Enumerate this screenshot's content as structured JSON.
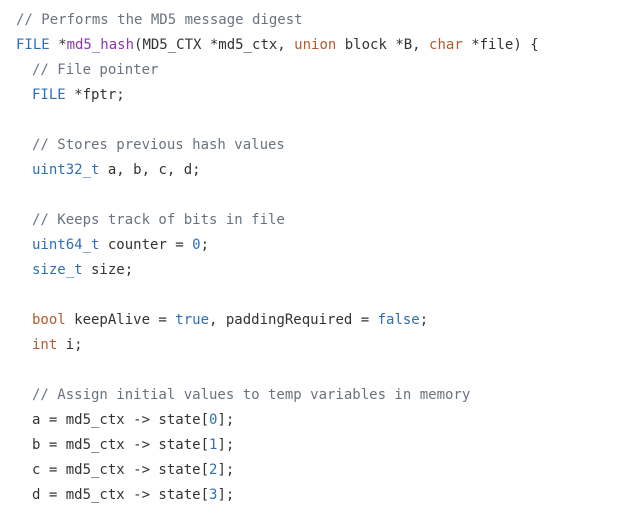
{
  "code": {
    "lines": [
      {
        "indent": 0,
        "tokens": [
          {
            "t": "// Performs the MD5 message digest",
            "k": "comment"
          }
        ]
      },
      {
        "indent": 0,
        "tokens": [
          {
            "t": "FILE",
            "k": "type"
          },
          {
            "t": " *",
            "k": "plain"
          },
          {
            "t": "md5_hash",
            "k": "func"
          },
          {
            "t": "(MD5_CTX *md5_ctx, ",
            "k": "plain"
          },
          {
            "t": "union",
            "k": "keyword"
          },
          {
            "t": " block *B, ",
            "k": "plain"
          },
          {
            "t": "char",
            "k": "keyword"
          },
          {
            "t": " *file) {",
            "k": "plain"
          }
        ]
      },
      {
        "indent": 1,
        "tokens": [
          {
            "t": "// File pointer",
            "k": "comment"
          }
        ]
      },
      {
        "indent": 1,
        "tokens": [
          {
            "t": "FILE",
            "k": "type"
          },
          {
            "t": " *fptr;",
            "k": "plain"
          }
        ]
      },
      {
        "indent": 1,
        "tokens": []
      },
      {
        "indent": 1,
        "tokens": [
          {
            "t": "// Stores previous hash values",
            "k": "comment"
          }
        ]
      },
      {
        "indent": 1,
        "tokens": [
          {
            "t": "uint32_t",
            "k": "type"
          },
          {
            "t": " a, b, c, d;",
            "k": "plain"
          }
        ]
      },
      {
        "indent": 1,
        "tokens": []
      },
      {
        "indent": 1,
        "tokens": [
          {
            "t": "// Keeps track of bits in file",
            "k": "comment"
          }
        ]
      },
      {
        "indent": 1,
        "tokens": [
          {
            "t": "uint64_t",
            "k": "type"
          },
          {
            "t": " counter = ",
            "k": "plain"
          },
          {
            "t": "0",
            "k": "value"
          },
          {
            "t": ";",
            "k": "plain"
          }
        ]
      },
      {
        "indent": 1,
        "tokens": [
          {
            "t": "size_t",
            "k": "type"
          },
          {
            "t": " size;",
            "k": "plain"
          }
        ]
      },
      {
        "indent": 1,
        "tokens": []
      },
      {
        "indent": 1,
        "tokens": [
          {
            "t": "bool",
            "k": "keyword"
          },
          {
            "t": " keepAlive = ",
            "k": "plain"
          },
          {
            "t": "true",
            "k": "value"
          },
          {
            "t": ", paddingRequired = ",
            "k": "plain"
          },
          {
            "t": "false",
            "k": "value"
          },
          {
            "t": ";",
            "k": "plain"
          }
        ]
      },
      {
        "indent": 1,
        "tokens": [
          {
            "t": "int",
            "k": "keyword"
          },
          {
            "t": " i;",
            "k": "plain"
          }
        ]
      },
      {
        "indent": 1,
        "tokens": []
      },
      {
        "indent": 1,
        "tokens": [
          {
            "t": "// Assign initial values to temp variables in memory",
            "k": "comment"
          }
        ]
      },
      {
        "indent": 1,
        "tokens": [
          {
            "t": "a = md5_ctx -> state[",
            "k": "plain"
          },
          {
            "t": "0",
            "k": "value"
          },
          {
            "t": "];",
            "k": "plain"
          }
        ]
      },
      {
        "indent": 1,
        "tokens": [
          {
            "t": "b = md5_ctx -> state[",
            "k": "plain"
          },
          {
            "t": "1",
            "k": "value"
          },
          {
            "t": "];",
            "k": "plain"
          }
        ]
      },
      {
        "indent": 1,
        "tokens": [
          {
            "t": "c = md5_ctx -> state[",
            "k": "plain"
          },
          {
            "t": "2",
            "k": "value"
          },
          {
            "t": "];",
            "k": "plain"
          }
        ]
      },
      {
        "indent": 1,
        "tokens": [
          {
            "t": "d = md5_ctx -> state[",
            "k": "plain"
          },
          {
            "t": "3",
            "k": "value"
          },
          {
            "t": "];",
            "k": "plain"
          }
        ]
      }
    ]
  }
}
